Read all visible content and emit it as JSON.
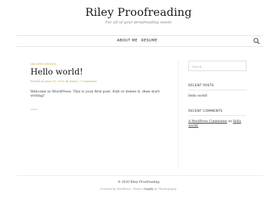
{
  "header": {
    "site_title": "Riley Proofreading",
    "tagline": "For all of your proofreading needs"
  },
  "nav": {
    "items": [
      {
        "label": "ABOUT ME"
      },
      {
        "label": "RESUME"
      }
    ],
    "search_icon": "search-icon"
  },
  "post": {
    "category": "UNCATEGORIZED",
    "title": "Hello world!",
    "meta_prefix": "Posted on",
    "date": "June 11, 2020",
    "meta_by": "by",
    "author": "Kaley",
    "separator": "/",
    "comments": "1 Comment",
    "excerpt": "Welcome to WordPress. This is your first post. Edit or delete it, then start writing!"
  },
  "sidebar": {
    "search_placeholder": "Search ...",
    "recent_posts_title": "RECENT POSTS",
    "recent_posts": [
      {
        "label": "Hello world!"
      }
    ],
    "recent_comments_title": "RECENT COMMENTS",
    "comment_author": "A WordPress Commenter",
    "comment_on": "on",
    "comment_post": "Hello world!"
  },
  "footer": {
    "copyright": "© 2020 Riley Proofreading",
    "powered_prefix": "Powered by",
    "powered_link": "WordPress",
    "theme_prefix": ". Theme:",
    "theme_name": "Graphy",
    "by": "by",
    "theme_author": "Themegraphy"
  }
}
